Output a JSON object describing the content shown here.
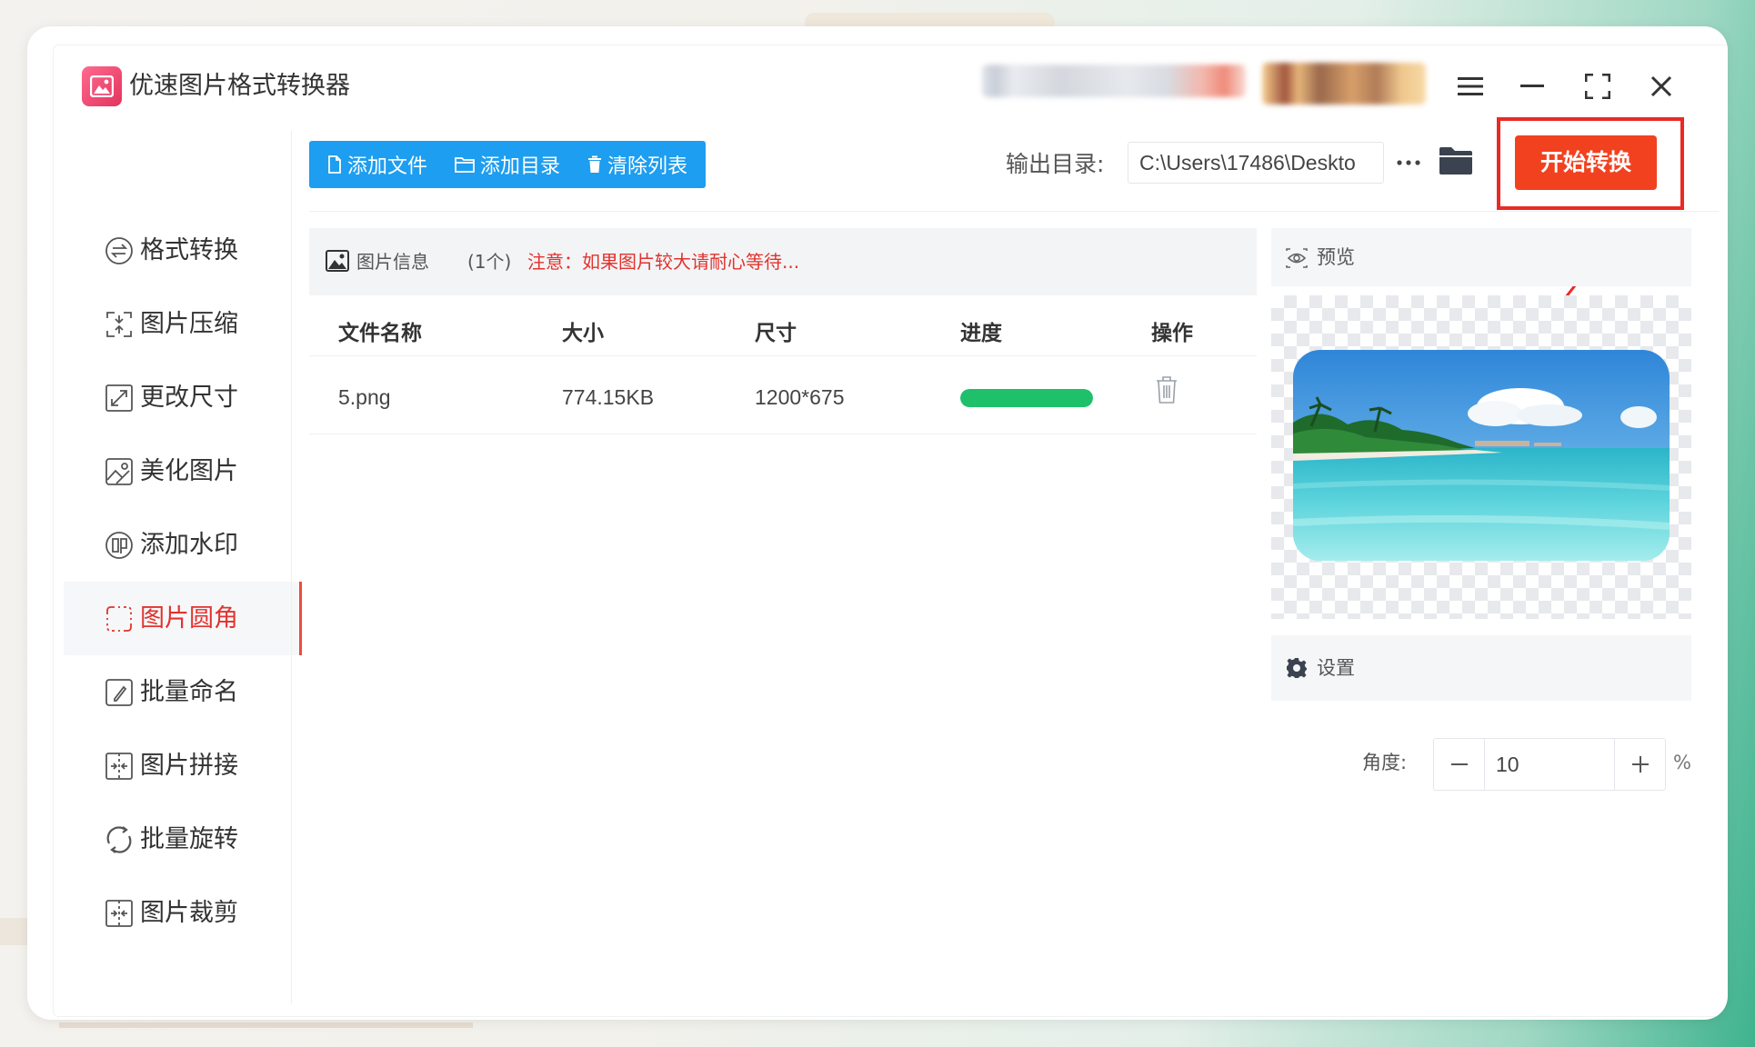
{
  "window": {
    "title": "优速图片格式转换器",
    "controls": [
      "menu-icon",
      "minimize-icon",
      "maximize-icon",
      "close-icon"
    ]
  },
  "sidebar": {
    "items": [
      {
        "label": "格式转换",
        "icon": "format-convert-icon",
        "active": false
      },
      {
        "label": "图片压缩",
        "icon": "compress-icon",
        "active": false
      },
      {
        "label": "更改尺寸",
        "icon": "resize-icon",
        "active": false
      },
      {
        "label": "美化图片",
        "icon": "beautify-icon",
        "active": false
      },
      {
        "label": "添加水印",
        "icon": "watermark-icon",
        "active": false
      },
      {
        "label": "图片圆角",
        "icon": "rounded-corner-icon",
        "active": true
      },
      {
        "label": "批量命名",
        "icon": "rename-icon",
        "active": false
      },
      {
        "label": "图片拼接",
        "icon": "stitch-icon",
        "active": false
      },
      {
        "label": "批量旋转",
        "icon": "rotate-icon",
        "active": false
      },
      {
        "label": "图片裁剪",
        "icon": "crop-icon",
        "active": false
      }
    ]
  },
  "toolbar": {
    "add_file": "添加文件",
    "add_dir": "添加目录",
    "clear_list": "清除列表",
    "output_label": "输出目录:",
    "output_path": "C:\\Users\\17486\\Deskto",
    "more": "···",
    "start_button": "开始转换"
  },
  "file_panel": {
    "title": "图片信息",
    "count": "(1个)",
    "warning": "注意：如果图片较大请耐心等待...",
    "columns": [
      "文件名称",
      "大小",
      "尺寸",
      "进度",
      "操作"
    ],
    "rows": [
      {
        "name": "5.png",
        "size": "774.15KB",
        "dimensions": "1200*675",
        "progress": 1.0
      }
    ]
  },
  "preview": {
    "label": "预览"
  },
  "settings": {
    "label": "设置",
    "angle_label": "角度:",
    "angle_value": "10",
    "unit": "%",
    "minus": "−",
    "plus": "+"
  },
  "colors": {
    "accent_blue": "#1d9ef0",
    "start_red": "#f2411f",
    "highlight_red": "#ea2a24",
    "progress_green": "#1fc06a",
    "active_nav": "#e2332e"
  }
}
